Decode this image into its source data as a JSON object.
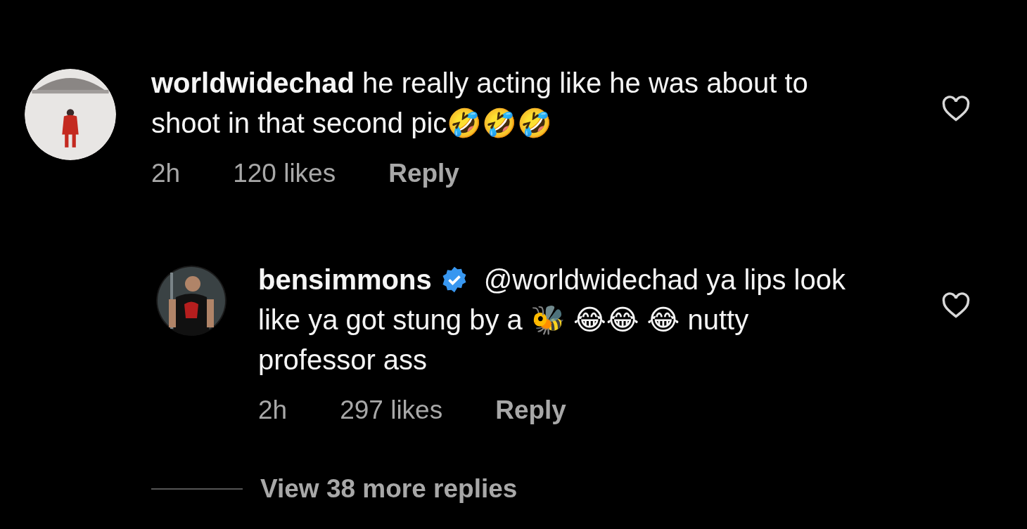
{
  "comments": [
    {
      "username": "worldwidechad",
      "verified": false,
      "text": "he really acting like he was about to shoot in that second pic🤣🤣🤣",
      "time": "2h",
      "likes": "120 likes",
      "reply": "Reply",
      "liked": false,
      "replies": [
        {
          "username": "bensimmons",
          "verified": true,
          "text": "@worldwidechad ya lips look like ya got stung by a 🐝 😂😂 😂 nutty professor ass",
          "time": "2h",
          "likes": "297 likes",
          "reply": "Reply",
          "liked": false
        }
      ]
    }
  ],
  "view_more": "View 38 more replies"
}
